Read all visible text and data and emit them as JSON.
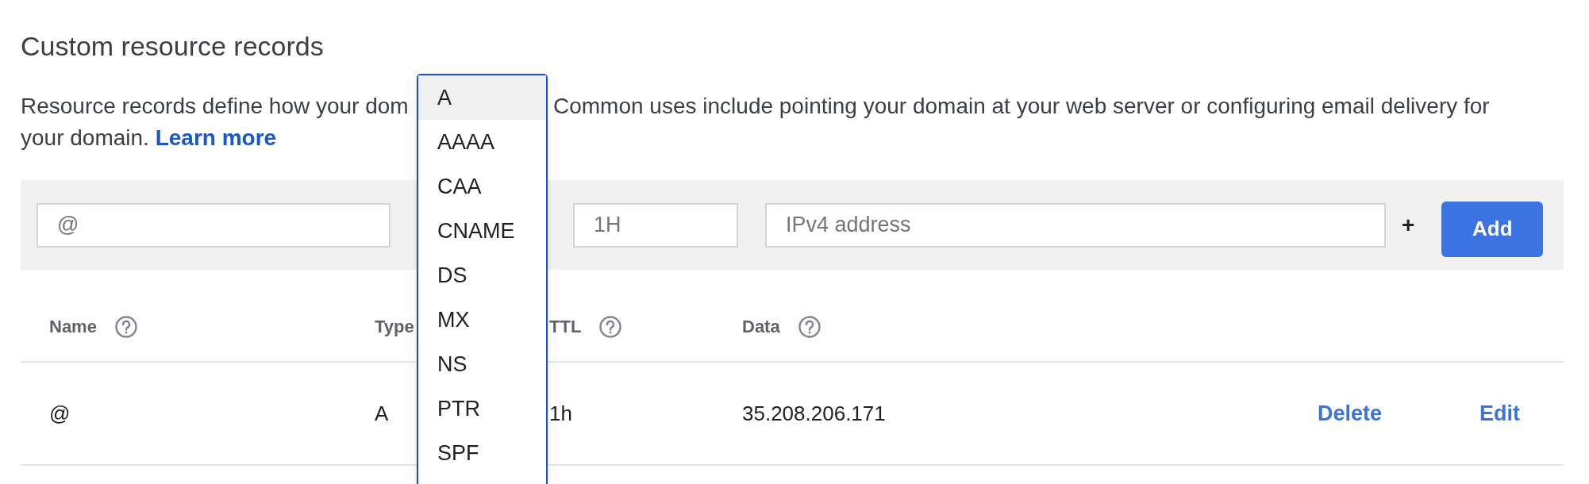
{
  "title": "Custom resource records",
  "description": {
    "text_before": "Resource records define how your dom",
    "text_after": "Common uses include pointing your domain at your web server or configuring email delivery for",
    "text_line2": "your domain.",
    "link": "Learn more"
  },
  "form": {
    "name_field": {
      "placeholder": "@"
    },
    "ttl_field": {
      "placeholder": "1H"
    },
    "data_field": {
      "placeholder": "IPv4 address"
    },
    "add_more": "+",
    "add_button": "Add"
  },
  "type_menu": {
    "options": [
      {
        "label": "A",
        "selected": true
      },
      {
        "label": "AAAA",
        "selected": false
      },
      {
        "label": "CAA",
        "selected": false
      },
      {
        "label": "CNAME",
        "selected": false
      },
      {
        "label": "DS",
        "selected": false
      },
      {
        "label": "MX",
        "selected": false
      },
      {
        "label": "NS",
        "selected": false
      },
      {
        "label": "PTR",
        "selected": false
      },
      {
        "label": "SPF",
        "selected": false
      }
    ]
  },
  "table": {
    "columns": [
      {
        "label": "Name",
        "help": true
      },
      {
        "label": "Type",
        "help": false
      },
      {
        "label": "TTL",
        "help": true
      },
      {
        "label": "Data",
        "help": true
      }
    ],
    "rows": [
      {
        "cells": [
          "@",
          "A",
          "1h",
          "35.208.206.171"
        ],
        "actions": [
          "Delete",
          "Edit"
        ]
      }
    ]
  }
}
